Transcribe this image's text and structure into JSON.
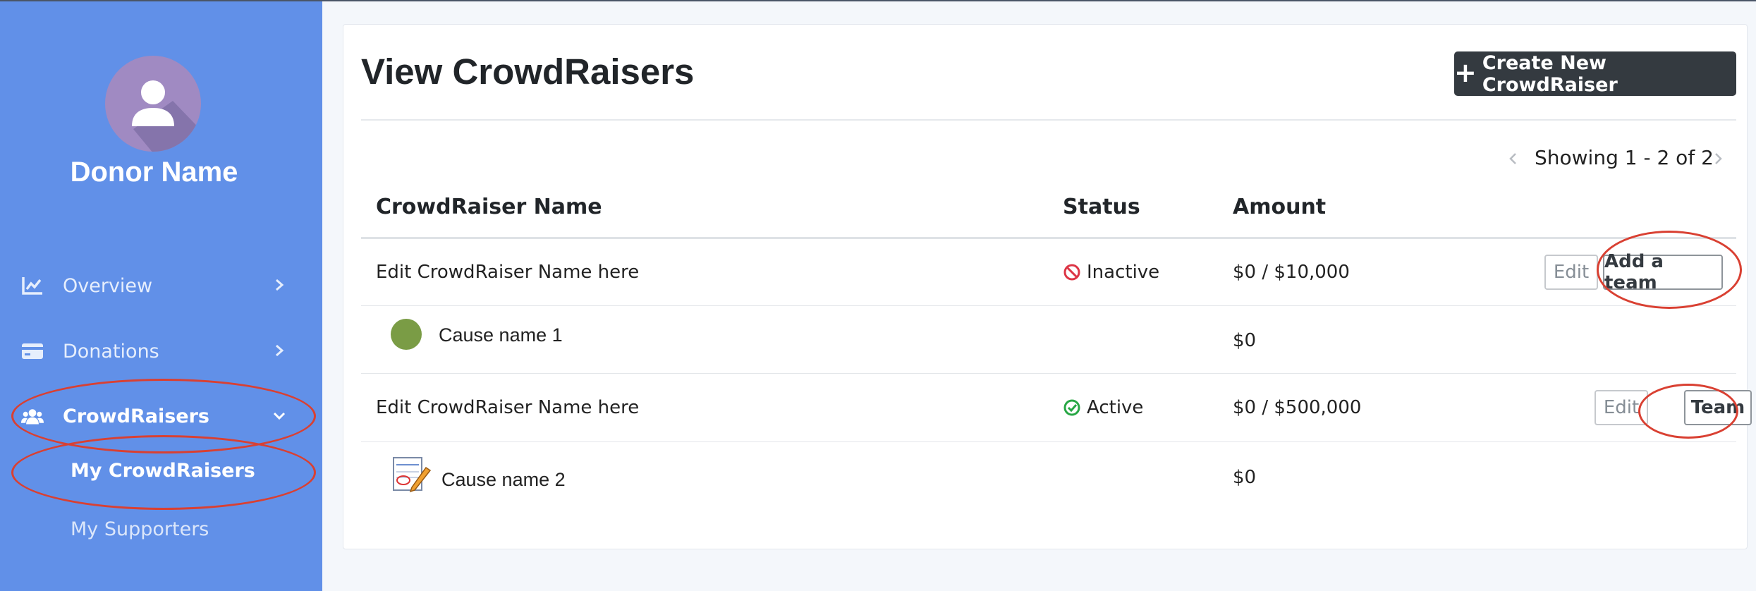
{
  "user": {
    "name": "Donor Name"
  },
  "sidebar": {
    "items": [
      {
        "label": "Overview",
        "icon": "chart-line-icon"
      },
      {
        "label": "Donations",
        "icon": "credit-card-icon"
      },
      {
        "label": "CrowdRaisers",
        "icon": "users-icon",
        "expanded": true
      }
    ],
    "subitems": [
      {
        "label": "My CrowdRaisers",
        "active": true
      },
      {
        "label": "My Supporters"
      }
    ]
  },
  "main": {
    "title": "View CrowdRaisers",
    "create_button": {
      "label": "Create New CrowdRaiser",
      "icon": "plus-icon"
    },
    "pagination": {
      "text": "Showing 1 - 2 of 2"
    },
    "table": {
      "headers": [
        "CrowdRaiser Name",
        "Status",
        "Amount"
      ],
      "rows": [
        {
          "name": "Edit CrowdRaiser Name here",
          "status": "Inactive",
          "amount": "$0 / $10,000",
          "actions": [
            "Edit",
            "Add a team"
          ]
        },
        {
          "cause": "Cause name 1",
          "amount": "$0"
        },
        {
          "name": "Edit CrowdRaiser Name here",
          "status": "Active",
          "amount": "$0 / $500,000",
          "actions": [
            "Edit",
            "Team"
          ]
        },
        {
          "cause": "Cause name 2",
          "amount": "$0"
        }
      ]
    }
  },
  "colors": {
    "sidebar_bg": "#6190e8",
    "button_dark": "#343a40",
    "status_inactive": "#dc3545",
    "status_active": "#28a745",
    "annotation": "#d94032"
  }
}
